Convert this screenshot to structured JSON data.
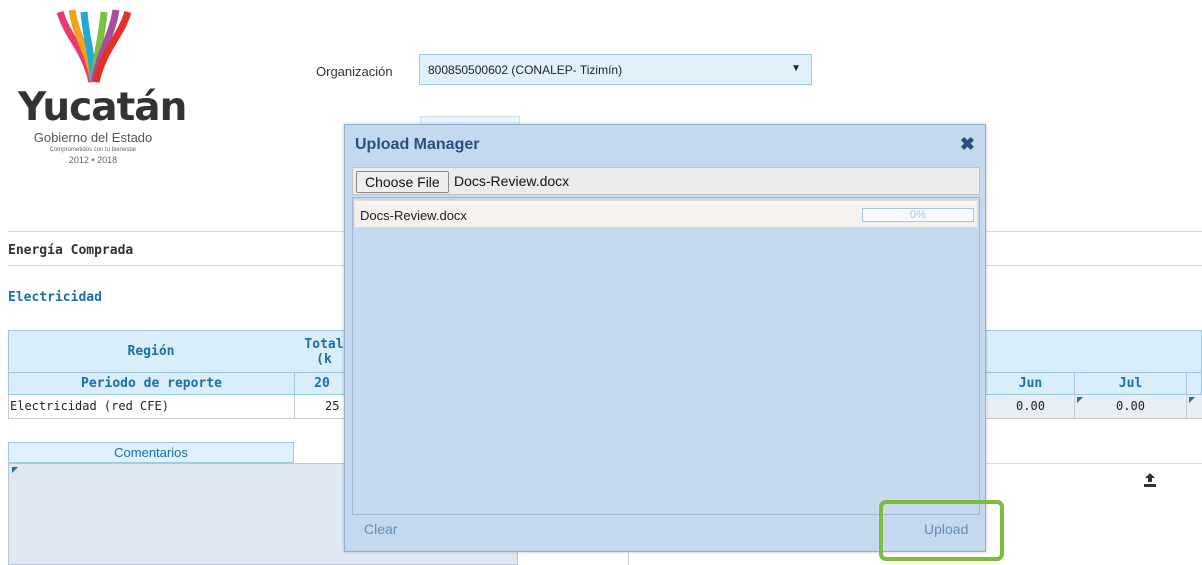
{
  "logo": {
    "title": "Yucatán",
    "subtitle": "Gobierno del Estado",
    "slogan": "Comprometidos con tu bienestar",
    "years": "2012 • 2018"
  },
  "organization": {
    "label": "Organización",
    "selected": "800850500602 (CONALEP- Tizimín)"
  },
  "sections": {
    "energy": "Energía Comprada",
    "electricity": "Electricidad"
  },
  "table": {
    "header1": [
      "Región",
      "Total",
      "(k"
    ],
    "header2": [
      "Periodo de reporte",
      "20",
      "Jun",
      "Jul"
    ],
    "row": {
      "label": "Electricidad (red CFE)",
      "total": "25",
      "jun": "0.00",
      "jul": "0.00"
    }
  },
  "comments": {
    "tab_label": "Comentarios"
  },
  "modal": {
    "title": "Upload Manager",
    "choose_button": "Choose File",
    "chosen_file": "Docs-Review.docx",
    "queue": [
      {
        "name": "Docs-Review.docx",
        "progress": "0%",
        "progress_value": 0
      }
    ],
    "clear_label": "Clear",
    "upload_label": "Upload"
  },
  "colors": {
    "accent": "#1a6fa6",
    "modal_bg": "#c5d9ee",
    "highlight": "#7dbb3c"
  },
  "icons": {
    "close": "close-icon",
    "upload": "upload-icon",
    "dropdown": "chevron-down-icon"
  }
}
